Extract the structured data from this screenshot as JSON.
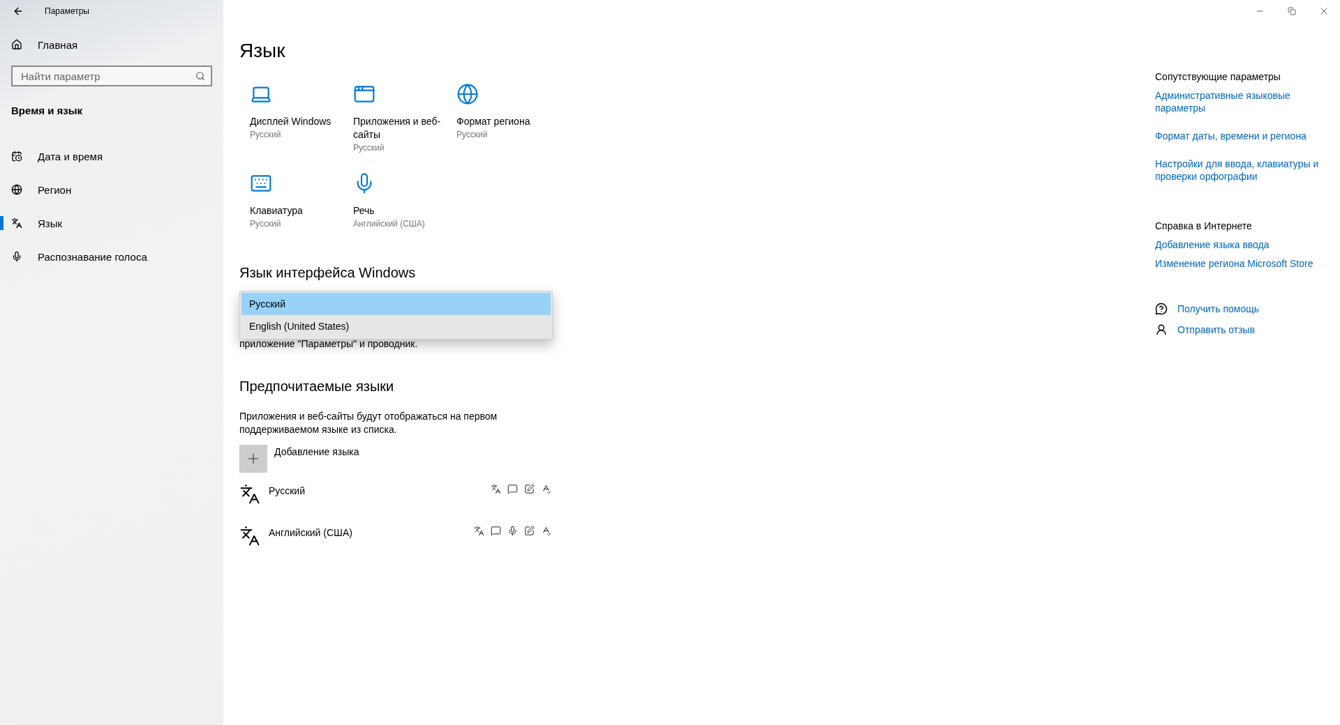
{
  "window": {
    "title": "Параметры"
  },
  "sidebar": {
    "home": "Главная",
    "search": {
      "placeholder": "Найти параметр"
    },
    "section": "Время и язык",
    "items": [
      {
        "label": "Дата и время",
        "kind": "calendar",
        "selected": false
      },
      {
        "label": "Регион",
        "kind": "globe",
        "selected": false
      },
      {
        "label": "Язык",
        "kind": "language",
        "selected": true
      },
      {
        "label": "Распознавание голоса",
        "kind": "mic",
        "selected": false
      }
    ]
  },
  "page": {
    "title": "Язык",
    "tiles": [
      {
        "kind": "display",
        "title": "Дисплей Windows",
        "value": "Русский"
      },
      {
        "kind": "apps",
        "title": "Приложения и веб-сайты",
        "value": "Русский"
      },
      {
        "kind": "region",
        "title": "Формат региона",
        "value": "Русский"
      },
      {
        "kind": "keyboard",
        "title": "Клавиатура",
        "value": "Русский"
      },
      {
        "kind": "speech",
        "title": "Речь",
        "value": "Английский (США)"
      }
    ],
    "interface_language": {
      "heading": "Язык интерфейса Windows",
      "options": [
        {
          "label": "Русский",
          "selected": true
        },
        {
          "label": "English (United States)",
          "selected": false
        }
      ],
      "note": "приложение \"Параметры\" и проводник."
    },
    "preferred": {
      "heading": "Предпочитаемые языки",
      "description": "Приложения и веб-сайты будут отображаться на первом поддерживаемом языке из списка.",
      "add": "Добавление языка",
      "languages": [
        {
          "name": "Русский",
          "speech": false
        },
        {
          "name": "Английский (США)",
          "speech": true
        }
      ]
    }
  },
  "related": {
    "heading": "Сопутствующие параметры",
    "links": [
      "Административные языковые параметры",
      "Формат даты, времени и региона",
      "Настройки для ввода, клавиатуры и проверки орфографии"
    ]
  },
  "help": {
    "heading": "Справка в Интернете",
    "links": [
      "Добавление языка ввода",
      "Изменение региона Microsoft Store"
    ]
  },
  "actions": [
    {
      "kind": "help",
      "label": "Получить помощь"
    },
    {
      "kind": "feedback",
      "label": "Отправить отзыв"
    }
  ]
}
